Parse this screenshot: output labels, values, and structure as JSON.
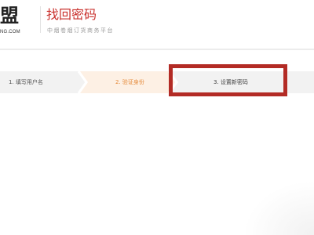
{
  "brand": {
    "logo_text": "盟",
    "logo_sub": "NG.COM"
  },
  "header": {
    "title": "找回密码",
    "subtitle": "中烟卷烟订货商务平台"
  },
  "steps": [
    {
      "label": "1. 填写用户名",
      "state": "done",
      "color": "#555555"
    },
    {
      "label": "2. 验证身份",
      "state": "active",
      "color": "#e58a3a"
    },
    {
      "label": "3. 设置新密码",
      "state": "pending",
      "color": "#444444"
    }
  ],
  "colors": {
    "accent": "#c9302c",
    "step_active_bg": "#fdf0e4",
    "step_inactive_bg": "#f2f2f2",
    "highlight_border": "#b32b25"
  }
}
